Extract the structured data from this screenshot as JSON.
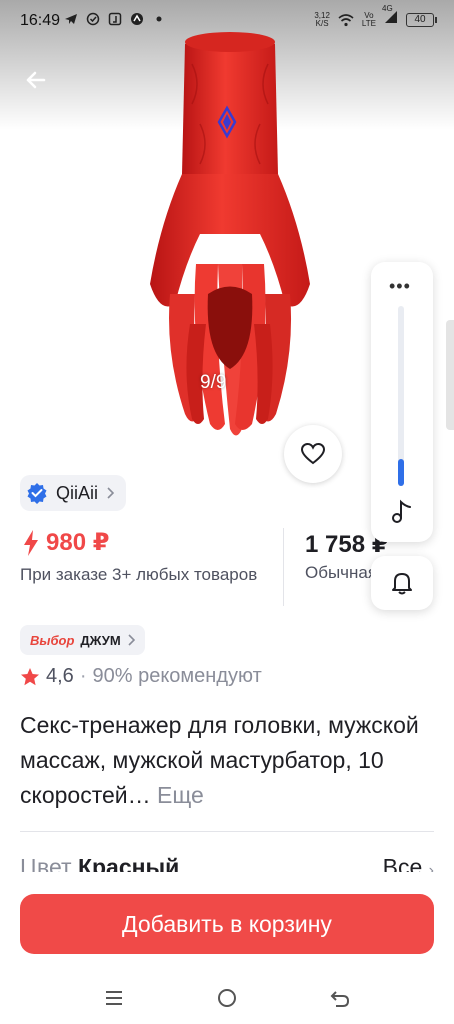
{
  "status_bar": {
    "time": "16:49",
    "speed": "3,12",
    "speed_unit": "K/S",
    "network": "Vo",
    "network2": "LTE",
    "signal_gen": "4G",
    "battery": "40"
  },
  "gallery": {
    "counter": "9/9"
  },
  "seller": {
    "name": "QiiAii"
  },
  "price": {
    "discounted": "980 ₽",
    "discounted_note": "При заказе 3+ любых товаров",
    "regular": "1 758 ₽",
    "regular_label": "Обычная"
  },
  "badge": {
    "part1": "Выбор",
    "part2": "ДЖУМ"
  },
  "rating": {
    "value": "4,6",
    "separator": "·",
    "recommend": "90% рекомендуют"
  },
  "product": {
    "title": "Секс-тренажер для головки, мужской массаж, мужской мастурбатор, 10 скоростей…",
    "more": "Еще"
  },
  "color": {
    "label": "Цвет",
    "value": "Красный",
    "all": "Все"
  },
  "cart": {
    "label": "Добавить в корзину"
  },
  "side_panel": {
    "volume_level": 0.15
  },
  "colors": {
    "accent_red": "#f04a48",
    "price_red": "#f04848",
    "verified_blue": "#2f6fe8",
    "slider_blue": "#2f6fe8"
  }
}
